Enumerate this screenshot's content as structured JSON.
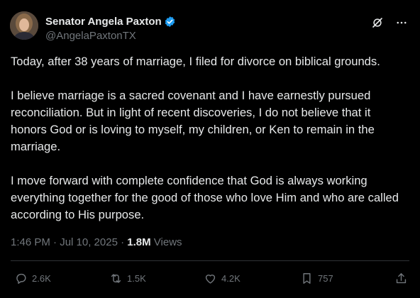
{
  "author": {
    "name": "Senator Angela Paxton",
    "handle": "@AngelaPaxtonTX"
  },
  "post": {
    "paragraphs": [
      "Today, after 38 years of marriage, I filed for divorce on biblical grounds.",
      "I believe marriage is a sacred covenant and I have earnestly pursued reconciliation. But in light of recent discoveries, I do not believe that it honors God or is loving to myself, my children, or Ken to remain in the marriage.",
      "I move forward with complete confidence that God is always working everything together for the good of those who love Him and who are called according to His purpose."
    ],
    "timestamp": "1:46 PM · Jul 10, 2025 · ",
    "views_count": "1.8M",
    "views_label": " Views"
  },
  "actions": {
    "replies": "2.6K",
    "reposts": "1.5K",
    "likes": "4.2K",
    "bookmarks": "757"
  },
  "colors": {
    "background": "#000000",
    "text": "#e7e9ea",
    "muted": "#71767b",
    "verified": "#1d9bf0",
    "divider": "#2f3336"
  },
  "icons": [
    "verified-badge-icon",
    "grok-icon",
    "more-icon",
    "reply-icon",
    "repost-icon",
    "like-icon",
    "bookmark-icon",
    "share-icon"
  ]
}
